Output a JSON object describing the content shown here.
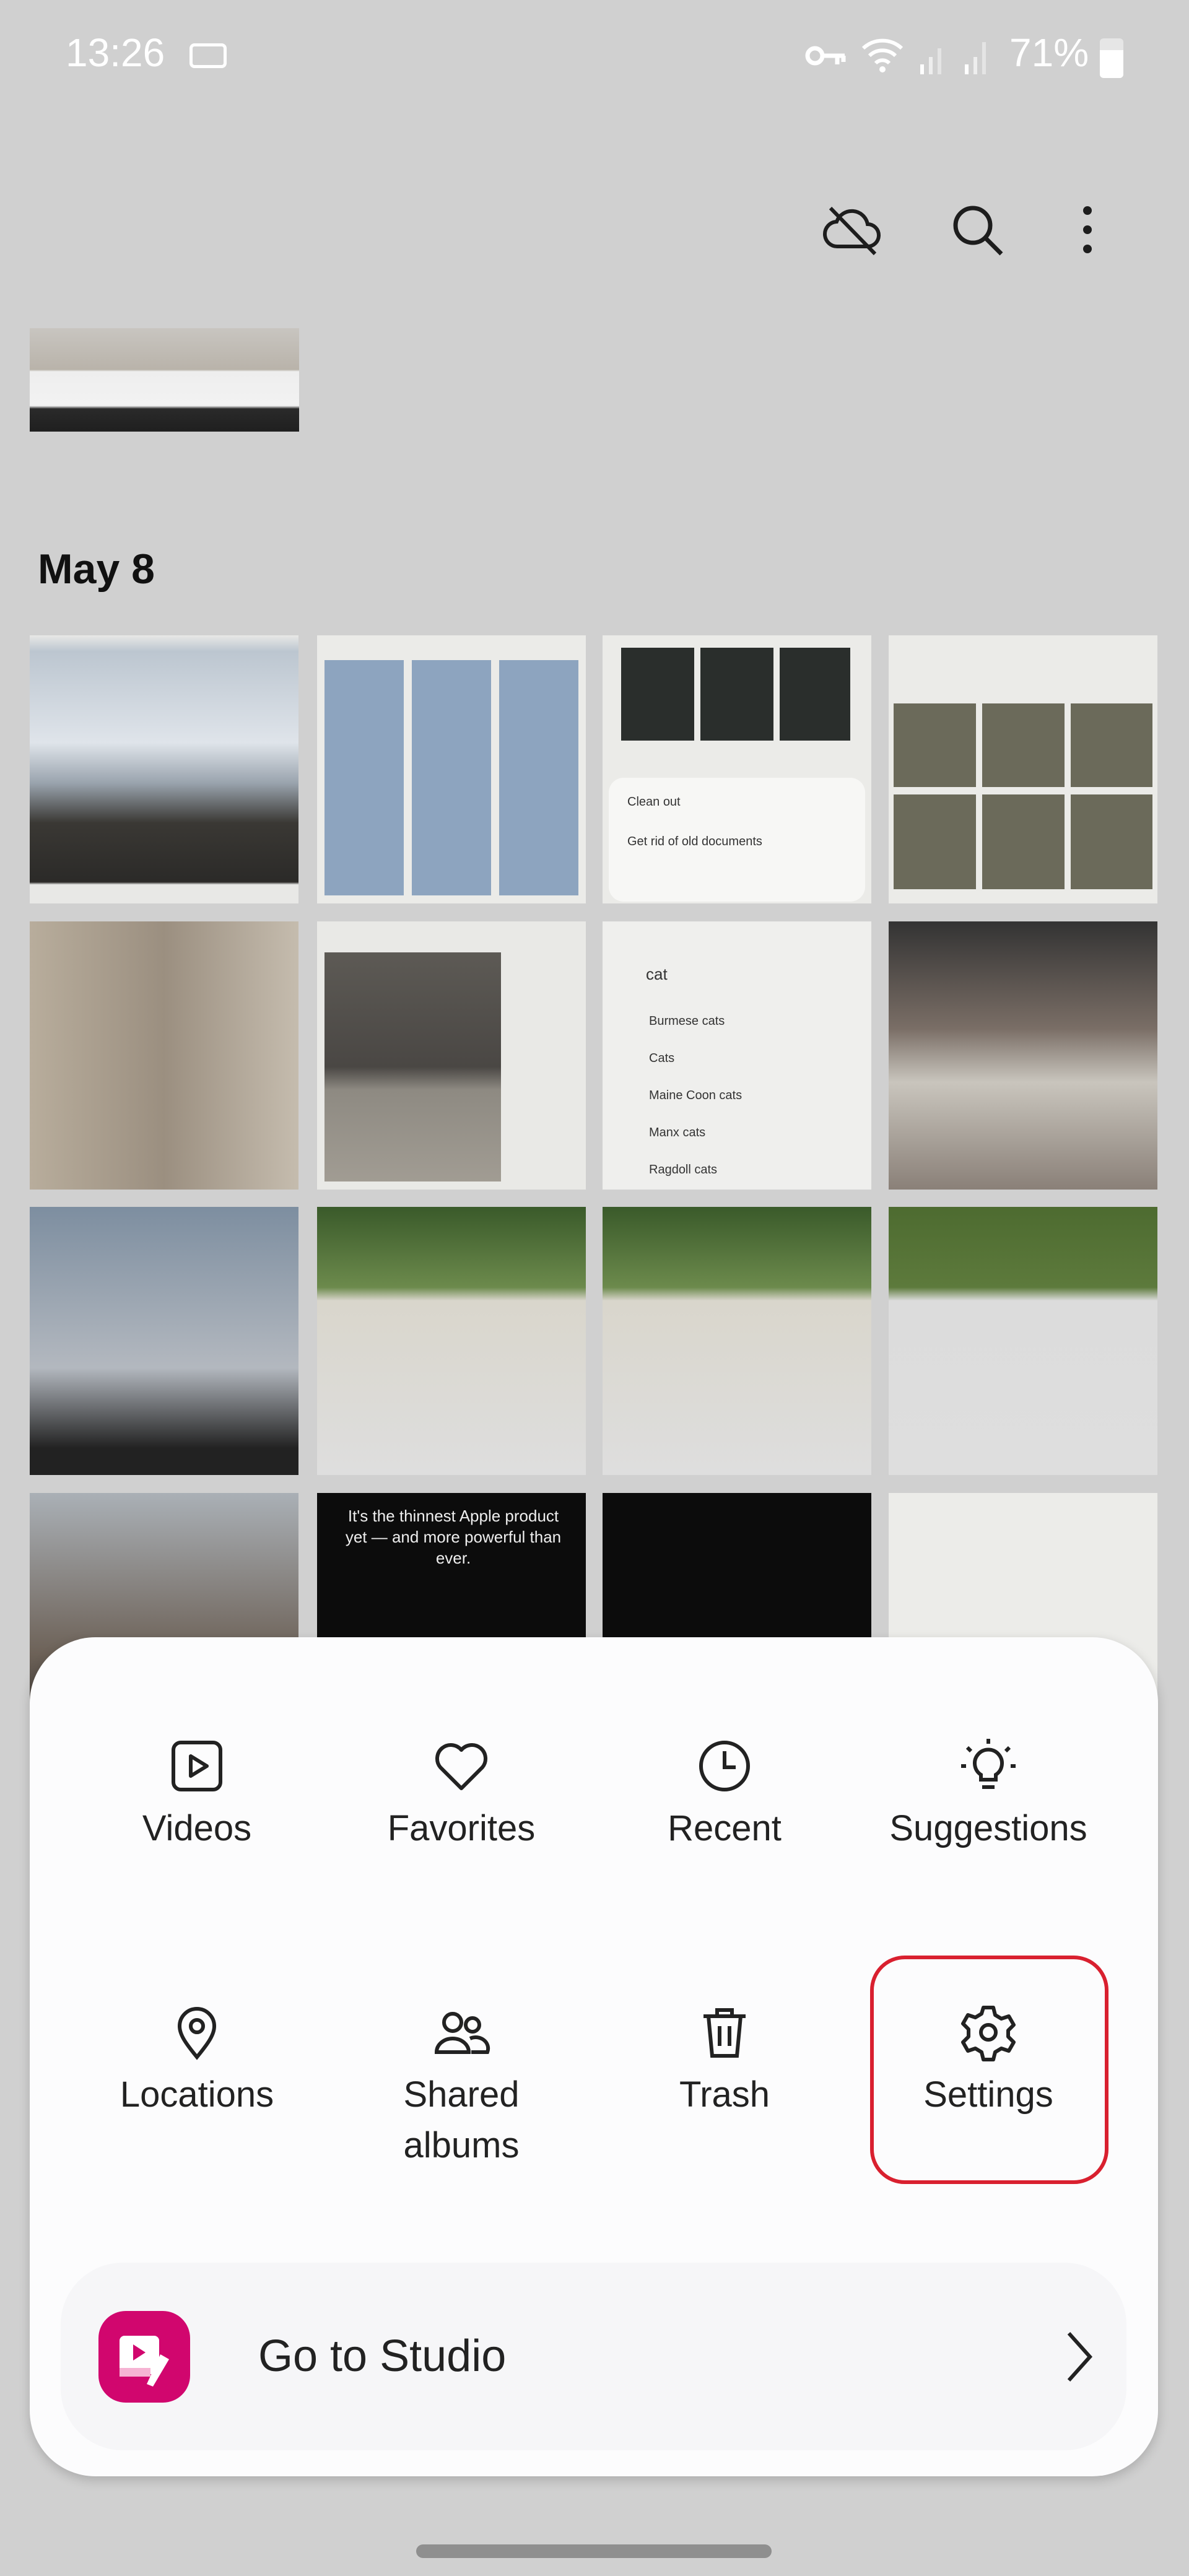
{
  "status_bar": {
    "time": "13:26",
    "battery": "71%",
    "battery_level": 71
  },
  "toolbar": {
    "icons": [
      "cloud-off-icon",
      "search-icon",
      "more-vert-icon"
    ]
  },
  "section": {
    "date": "May 8"
  },
  "thumbnails": {
    "t3": {
      "title": "Clean out",
      "text": "Get rid of old documents"
    },
    "t7": {
      "query": "cat",
      "items": [
        "Burmese cats",
        "Cats",
        "Maine Coon cats",
        "Manx cats",
        "Ragdoll cats"
      ]
    },
    "t14": {
      "text": "It's the thinnest Apple product yet — and more powerful than ever."
    }
  },
  "menu": {
    "items": [
      {
        "label": "Videos",
        "icon": "video-icon"
      },
      {
        "label": "Favorites",
        "icon": "heart-icon"
      },
      {
        "label": "Recent",
        "icon": "clock-icon"
      },
      {
        "label": "Suggestions",
        "icon": "lightbulb-icon"
      },
      {
        "label": "Locations",
        "icon": "location-pin-icon"
      },
      {
        "label": "Shared albums",
        "icon": "people-icon"
      },
      {
        "label": "Trash",
        "icon": "trash-icon"
      },
      {
        "label": "Settings",
        "icon": "gear-icon"
      }
    ],
    "highlight_color": "#d9202f",
    "studio": {
      "label": "Go to Studio",
      "icon_color": "#d1066e"
    }
  }
}
